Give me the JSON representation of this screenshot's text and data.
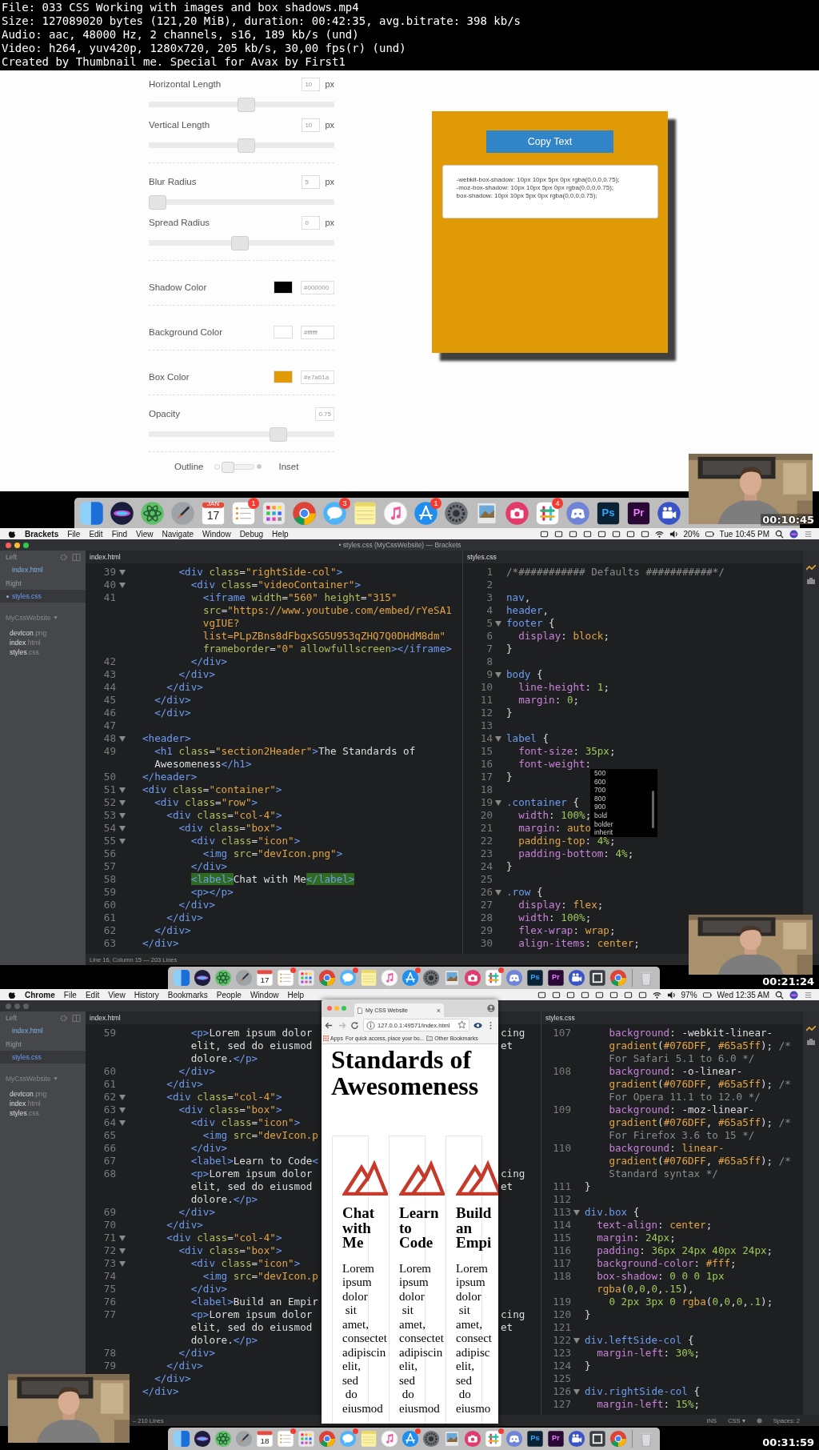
{
  "file_info": [
    "File: 033 CSS Working with images and box shadows.mp4",
    "Size: 127089020 bytes (121,20 MiB), duration: 00:42:35, avg.bitrate: 398 kb/s",
    "Audio: aac, 48000 Hz, 2 channels, s16, 189 kb/s (und)",
    "Video: h264, yuv420p, 1280x720, 205 kb/s, 30,00 fps(r) (und)",
    "Created by Thumbnail me. Special for Avax by First1"
  ],
  "frames": [
    {
      "kind": "generator",
      "timestamp": "00:10:45",
      "control_groups": [
        {
          "controls": [
            {
              "kind": "slider",
              "label": "Horizontal Length",
              "value": "10",
              "unit": "px",
              "level": 0.53
            },
            {
              "kind": "slider",
              "label": "Vertical Length",
              "value": "10",
              "unit": "px",
              "level": 0.53
            }
          ]
        },
        {
          "controls": [
            {
              "kind": "slider",
              "label": "Blur Radius",
              "value": "5",
              "unit": "px",
              "level": 0
            },
            {
              "kind": "slider",
              "label": "Spread Radius",
              "value": "0",
              "unit": "px",
              "level": 0.49
            }
          ]
        },
        {
          "controls": [
            {
              "kind": "color",
              "label": "Shadow Color",
              "color": "#000000",
              "value": "#000000"
            }
          ]
        },
        {
          "controls": [
            {
              "kind": "color",
              "label": "Background Color",
              "color": "#ffffff",
              "value": "#ffffff"
            }
          ]
        },
        {
          "controls": [
            {
              "kind": "color",
              "label": "Box Color",
              "color": "#e09a06",
              "value": "#e7a61a"
            }
          ]
        },
        {
          "controls": [
            {
              "kind": "slider",
              "label": "Opacity",
              "value": "0.75",
              "level": 0.72
            }
          ]
        },
        {
          "controls": [
            {
              "kind": "toggle",
              "off_label": "Outline",
              "on_label": "Inset",
              "on": false
            }
          ]
        }
      ],
      "preview": {
        "button": "Copy Text",
        "code": [
          "-webkit-box-shadow: 10px 10px 5px 0px rgba(0,0,0,0.75);",
          "-moz-box-shadow: 10px 10px 5px 0px rgba(0,0,0,0.75);",
          "box-shadow: 10px 10px 5px 0px rgba(0,0,0,0.75);"
        ]
      },
      "dock": [
        {
          "kind": "finder"
        },
        {
          "kind": "siri"
        },
        {
          "kind": "atom"
        },
        {
          "kind": "rocket"
        },
        {
          "kind": "calendar",
          "month": "JAN",
          "label": "17"
        },
        {
          "kind": "reminders",
          "badge": "1"
        },
        {
          "kind": "launchpad"
        },
        {
          "kind": "chrome"
        },
        {
          "kind": "messages",
          "badge": "3"
        },
        {
          "kind": "notes"
        },
        {
          "kind": "music"
        },
        {
          "kind": "appstore",
          "badge": "1"
        },
        {
          "kind": "settings"
        },
        {
          "kind": "preview"
        },
        {
          "kind": "camera"
        },
        {
          "kind": "slack",
          "badge": "4"
        },
        {
          "kind": "discord"
        },
        {
          "kind": "photoshop",
          "label": "Ps"
        },
        {
          "kind": "premiere",
          "label": "Pr"
        },
        {
          "kind": "clapper"
        }
      ]
    },
    {
      "kind": "editor",
      "timestamp": "00:21:24",
      "menu_bar": {
        "app": "Brackets",
        "menus": [
          "File",
          "Edit",
          "Find",
          "View",
          "Navigate",
          "Window",
          "Debug",
          "Help"
        ],
        "battery": "20%",
        "clock": "Tue 10:45 PM"
      },
      "window": {
        "active": true,
        "title": "• styles.css (MyCssWebsite) — Brackets"
      },
      "sidebar": {
        "working_sets": [
          {
            "label": "Left",
            "files": [
              {
                "name": "index.html",
                "selected": false,
                "modified": false
              }
            ]
          },
          {
            "label": "Right",
            "files": [
              {
                "name": "styles.css",
                "selected": true,
                "modified": true
              }
            ]
          }
        ],
        "project": "MyCssWebsite",
        "project_files": [
          "devIcon.png",
          "index.html",
          "styles.css"
        ]
      },
      "panes": [
        {
          "tab": "index.html",
          "kind": "html",
          "lines": [
            {
              "number": "39",
              "fold": true,
              "code": "      <div class=\"rightSide-col\">"
            },
            {
              "number": "40",
              "fold": true,
              "code": "        <div class=\"videoContainer\">"
            },
            {
              "number": "41",
              "fold": false,
              "code": "          <iframe width=\"560\" height=\"315\""
            },
            {
              "fold": false,
              "code": "          src=\"https://www.youtube.com/embed/rYeSA1"
            },
            {
              "fold": false,
              "code": "          vgIUE?"
            },
            {
              "fold": false,
              "code": "          list=PLpZBns8dFbgxSG5U953qZHQ7Q0DHdM8dm\""
            },
            {
              "fold": false,
              "code": "          frameborder=\"0\" allowfullscreen></iframe>"
            },
            {
              "number": "42",
              "fold": false,
              "code": "        </div>"
            },
            {
              "number": "43",
              "fold": false,
              "code": "      </div>"
            },
            {
              "number": "44",
              "fold": false,
              "code": "    </div>"
            },
            {
              "number": "45",
              "fold": false,
              "code": "  </div>"
            },
            {
              "number": "46",
              "fold": false,
              "code": "  </div>"
            },
            {
              "number": "47",
              "fold": false
            },
            {
              "number": "48",
              "fold": true,
              "code": "<header>"
            },
            {
              "number": "49",
              "fold": false,
              "code": "  <h1 class=\"section2Header\">The Standards of"
            },
            {
              "fold": false,
              "code": "  Awesomeness</h1>"
            },
            {
              "number": "50",
              "fold": false,
              "code": "</header>"
            },
            {
              "number": "51",
              "fold": true,
              "code": "<div class=\"container\">"
            },
            {
              "number": "52",
              "fold": true,
              "code": "  <div class=\"row\">"
            },
            {
              "number": "53",
              "fold": true,
              "code": "    <div class=\"col-4\">"
            },
            {
              "number": "54",
              "fold": true,
              "code": "      <div class=\"box\">"
            },
            {
              "number": "55",
              "fold": true,
              "code": "        <div class=\"icon\">"
            },
            {
              "number": "56",
              "fold": false,
              "code": "          <img src=\"devIcon.png\">"
            },
            {
              "number": "57",
              "fold": false,
              "code": "        </div>"
            },
            {
              "number": "58",
              "fold": false,
              "matched": true,
              "code": "        <label>Chat with Me</label>"
            },
            {
              "number": "59",
              "fold": false,
              "code": "        <p></p>"
            },
            {
              "number": "60",
              "fold": false,
              "code": "      </div>"
            },
            {
              "number": "61",
              "fold": false,
              "code": "    </div>"
            },
            {
              "number": "62",
              "fold": false,
              "code": "  </div>"
            },
            {
              "number": "63",
              "fold": false,
              "code": "</div>"
            }
          ]
        },
        {
          "tab": "styles.css",
          "kind": "css",
          "lines": [
            {
              "number": "1",
              "fold": false,
              "code": "/*########### Defaults ###########*/"
            },
            {
              "number": "2",
              "fold": false
            },
            {
              "number": "3",
              "fold": false,
              "code": "nav,"
            },
            {
              "number": "4",
              "fold": false,
              "code": "header,"
            },
            {
              "number": "5",
              "fold": true,
              "code": "footer {"
            },
            {
              "number": "6",
              "fold": false,
              "code": "  display: block;"
            },
            {
              "number": "7",
              "fold": false,
              "code": "}"
            },
            {
              "number": "8",
              "fold": false
            },
            {
              "number": "9",
              "fold": true,
              "code": "body {"
            },
            {
              "number": "10",
              "fold": false,
              "code": "  line-height: 1;"
            },
            {
              "number": "11",
              "fold": false,
              "code": "  margin: 0;"
            },
            {
              "number": "12",
              "fold": false,
              "code": "}"
            },
            {
              "number": "13",
              "fold": false
            },
            {
              "number": "14",
              "fold": true,
              "code": "label {"
            },
            {
              "number": "15",
              "fold": false,
              "code": "  font-size: 35px;"
            },
            {
              "number": "16",
              "fold": false,
              "code": "  font-weight:"
            },
            {
              "number": "17",
              "fold": false,
              "code": "}"
            },
            {
              "number": "18",
              "fold": false
            },
            {
              "number": "19",
              "fold": true,
              "code": ".container {"
            },
            {
              "number": "20",
              "fold": false,
              "code": "  width: 100%;"
            },
            {
              "number": "21",
              "fold": false,
              "code": "  margin: auto"
            },
            {
              "number": "22",
              "fold": false,
              "code": "  padding-top: 4%;"
            },
            {
              "number": "23",
              "fold": false,
              "code": "  padding-bottom: 4%;"
            },
            {
              "number": "24",
              "fold": false,
              "code": "}"
            },
            {
              "number": "25",
              "fold": false
            },
            {
              "number": "26",
              "fold": true,
              "code": ".row {"
            },
            {
              "number": "27",
              "fold": false,
              "code": "  display: flex;"
            },
            {
              "number": "28",
              "fold": false,
              "code": "  width: 100%;"
            },
            {
              "number": "29",
              "fold": false,
              "code": "  flex-wrap: wrap;"
            },
            {
              "number": "30",
              "fold": false,
              "code": "  align-items: center;"
            }
          ]
        }
      ],
      "autocomplete": [
        "500",
        "600",
        "700",
        "800",
        "900",
        "bold",
        "bolder",
        "inherit"
      ],
      "status": {
        "left": "Line 16, Column 15 — 203 Lines"
      },
      "dock": [
        {
          "kind": "finder",
          "alert": false
        },
        {
          "kind": "siri",
          "alert": false
        },
        {
          "kind": "atom",
          "alert": false
        },
        {
          "kind": "rocket",
          "alert": false
        },
        {
          "kind": "calendar",
          "label": "17",
          "alert": false
        },
        {
          "kind": "reminders",
          "alert": true
        },
        {
          "kind": "launchpad",
          "alert": false
        },
        {
          "kind": "chrome",
          "alert": false
        },
        {
          "kind": "messages",
          "alert": true
        },
        {
          "kind": "notes",
          "alert": false
        },
        {
          "kind": "music",
          "alert": false
        },
        {
          "kind": "appstore",
          "alert": true
        },
        {
          "kind": "settings",
          "alert": false
        },
        {
          "kind": "preview",
          "alert": false
        },
        {
          "kind": "camera",
          "alert": false
        },
        {
          "kind": "slack",
          "alert": true
        },
        {
          "kind": "discord",
          "alert": false
        },
        {
          "kind": "photoshop",
          "label": "Ps",
          "alert": false
        },
        {
          "kind": "premiere",
          "label": "Pr",
          "alert": false
        },
        {
          "kind": "clapper",
          "alert": false
        },
        {
          "kind": "screenshot",
          "alert": false
        },
        {
          "kind": "chrome",
          "alert": false
        },
        {
          "kind": "separator"
        },
        {
          "kind": "trash",
          "alert": false
        }
      ]
    },
    {
      "kind": "editor",
      "timestamp": "00:31:59",
      "menu_bar": {
        "app": "Chrome",
        "menus": [
          "File",
          "Edit",
          "View",
          "History",
          "Bookmarks",
          "People",
          "Window",
          "Help"
        ],
        "battery": "97%",
        "clock": "Wed 12:35 AM"
      },
      "window": {
        "active": false
      },
      "sidebar": {
        "working_sets": [
          {
            "label": "Left",
            "files": [
              {
                "name": "index.html",
                "selected": false,
                "modified": false
              }
            ]
          },
          {
            "label": "Right",
            "files": [
              {
                "name": "styles.css",
                "selected": true,
                "modified": false
              }
            ]
          }
        ],
        "project": "MyCssWebsite",
        "project_files": [
          "devIcon.png",
          "index.html",
          "styles.css"
        ]
      },
      "panes": [
        {
          "tab": "index.html",
          "kind": "html",
          "lines": [
            {
              "number": "59",
              "fold": false,
              "code": "        <p>Lorem ipsum dolor",
              "tail": "cing"
            },
            {
              "fold": false,
              "code": "        elit, sed do eiusmod",
              "tail": "et"
            },
            {
              "fold": false,
              "code": "        dolore.</p>"
            },
            {
              "number": "60",
              "fold": false,
              "code": "      </div>"
            },
            {
              "number": "61",
              "fold": false,
              "code": "    </div>"
            },
            {
              "number": "62",
              "fold": true,
              "code": "    <div class=\"col-4\">"
            },
            {
              "number": "63",
              "fold": true,
              "code": "      <div class=\"box\">"
            },
            {
              "number": "64",
              "fold": true,
              "code": "        <div class=\"icon\">"
            },
            {
              "number": "65",
              "fold": false,
              "code": "          <img src=\"devIcon.p"
            },
            {
              "number": "66",
              "fold": false,
              "code": "        </div>"
            },
            {
              "number": "67",
              "fold": false,
              "code": "        <label>Learn to Code<"
            },
            {
              "number": "68",
              "fold": false,
              "code": "        <p>Lorem ipsum dolor",
              "tail": "cing"
            },
            {
              "fold": false,
              "code": "        elit, sed do eiusmod",
              "tail": "et"
            },
            {
              "fold": false,
              "code": "        dolore.</p>"
            },
            {
              "number": "69",
              "fold": false,
              "code": "      </div>"
            },
            {
              "number": "70",
              "fold": false,
              "code": "    </div>"
            },
            {
              "number": "71",
              "fold": true,
              "code": "    <div class=\"col-4\">"
            },
            {
              "number": "72",
              "fold": true,
              "code": "      <div class=\"box\">"
            },
            {
              "number": "73",
              "fold": true,
              "code": "        <div class=\"icon\">"
            },
            {
              "number": "74",
              "fold": false,
              "code": "          <img src=\"devIcon.p"
            },
            {
              "number": "75",
              "fold": false,
              "code": "        </div>"
            },
            {
              "number": "76",
              "fold": false,
              "code": "        <label>Build an Empir"
            },
            {
              "number": "77",
              "fold": false,
              "code": "        <p>Lorem ipsum dolor",
              "tail": "cing"
            },
            {
              "fold": false,
              "code": "        elit, sed do eiusmod",
              "tail": "et"
            },
            {
              "fold": false,
              "code": "        dolore.</p>"
            },
            {
              "number": "78",
              "fold": false,
              "code": "      </div>"
            },
            {
              "number": "79",
              "fold": false,
              "code": "    </div>"
            },
            {
              "fold": false,
              "code": "  </div>"
            },
            {
              "fold": false,
              "code": "</div>"
            }
          ]
        },
        {
          "tab": "styles.css",
          "kind": "css",
          "lines": [
            {
              "number": "107",
              "fold": false,
              "code": "    background: -webkit-linear-"
            },
            {
              "fold": false,
              "code": "    gradient(#076DFF, #65a5ff); /*"
            },
            {
              "fold": false,
              "code": "    For Safari 5.1 to 6.0 */"
            },
            {
              "number": "108",
              "fold": false,
              "code": "    background: -o-linear-"
            },
            {
              "fold": false,
              "code": "    gradient(#076DFF, #65a5ff); /*"
            },
            {
              "fold": false,
              "code": "    For Opera 11.1 to 12.0 */"
            },
            {
              "number": "109",
              "fold": false,
              "code": "    background: -moz-linear-"
            },
            {
              "fold": false,
              "code": "    gradient(#076DFF, #65a5ff); /*"
            },
            {
              "fold": false,
              "code": "    For Firefox 3.6 to 15 */"
            },
            {
              "number": "110",
              "fold": false,
              "code": "    background: linear-"
            },
            {
              "fold": false,
              "code": "    gradient(#076DFF, #65a5ff); /*"
            },
            {
              "fold": false,
              "code": "    Standard syntax */"
            },
            {
              "number": "111",
              "fold": false,
              "code": "}"
            },
            {
              "number": "112",
              "fold": false
            },
            {
              "number": "113",
              "fold": true,
              "code": "div.box {"
            },
            {
              "number": "114",
              "fold": false,
              "code": "  text-align: center;"
            },
            {
              "number": "115",
              "fold": false,
              "code": "  margin: 24px;"
            },
            {
              "number": "116",
              "fold": false,
              "code": "  padding: 36px 24px 40px 24px;"
            },
            {
              "number": "117",
              "fold": false,
              "code": "  background-color: #fff;"
            },
            {
              "number": "118",
              "fold": false,
              "code": "  box-shadow: 0 0 0 1px"
            },
            {
              "fold": false,
              "code": "  rgba(0,0,0,.15),"
            },
            {
              "number": "119",
              "fold": false,
              "code": "    0 2px 3px 0 rgba(0,0,0,.1);"
            },
            {
              "number": "120",
              "fold": false,
              "code": "}"
            },
            {
              "number": "121",
              "fold": false
            },
            {
              "number": "122",
              "fold": true,
              "code": "div.leftSide-col {"
            },
            {
              "number": "123",
              "fold": false,
              "code": "  margin-left: 30%;"
            },
            {
              "number": "124",
              "fold": false,
              "code": "}"
            },
            {
              "number": "125",
              "fold": false
            },
            {
              "number": "126",
              "fold": true,
              "code": "div.rightSide-col {"
            },
            {
              "number": "127",
              "fold": false,
              "code": "  margin-left: 15%;"
            }
          ]
        }
      ],
      "status": {
        "left": "– 210 Lines",
        "right": [
          "INS",
          "CSS ▾",
          "Spaces: 2"
        ]
      },
      "browser": {
        "tab": "My CSS Website",
        "close": "×",
        "url": "127.0.0.1:49571/index.html",
        "bookmarks": [
          "Apps",
          "For quick access, place your bo...",
          "Other Bookmarks"
        ],
        "heading": "Standards of Awesomeness",
        "cards": [
          {
            "title": "Chat with Me",
            "lines": [
              "Lorem",
              "ipsum",
              "dolor",
              " sit",
              "amet,",
              "consectet",
              "adipiscin",
              "elit,",
              "sed",
              " do",
              "eiusmod"
            ]
          },
          {
            "title": "Learn to Code",
            "lines": [
              "Lorem",
              "ipsum",
              "dolor",
              " sit",
              "amet,",
              "consectet",
              "adipiscin",
              "elit,",
              "sed",
              " do",
              "eiusmod"
            ]
          },
          {
            "title": "Build an Empi",
            "lines": [
              "Lorem",
              "ipsum",
              "dolor",
              " sit",
              "amet,",
              "consect",
              "adipisc",
              "elit,",
              "sed",
              " do",
              "eiusmo"
            ]
          }
        ]
      },
      "dock": [
        {
          "kind": "finder",
          "alert": false
        },
        {
          "kind": "siri",
          "alert": false
        },
        {
          "kind": "atom",
          "alert": false
        },
        {
          "kind": "rocket",
          "alert": false
        },
        {
          "kind": "calendar",
          "label": "18",
          "alert": false
        },
        {
          "kind": "reminders",
          "alert": true
        },
        {
          "kind": "launchpad",
          "alert": false
        },
        {
          "kind": "chrome",
          "alert": false
        },
        {
          "kind": "messages",
          "alert": true
        },
        {
          "kind": "notes",
          "alert": false
        },
        {
          "kind": "music",
          "alert": false
        },
        {
          "kind": "appstore",
          "alert": true
        },
        {
          "kind": "settings",
          "alert": false
        },
        {
          "kind": "preview",
          "alert": false
        },
        {
          "kind": "camera",
          "alert": false
        },
        {
          "kind": "slack",
          "alert": true
        },
        {
          "kind": "discord",
          "alert": false
        },
        {
          "kind": "photoshop",
          "label": "Ps",
          "alert": false
        },
        {
          "kind": "premiere",
          "label": "Pr",
          "alert": false
        },
        {
          "kind": "clapper",
          "alert": false
        },
        {
          "kind": "screenshot",
          "alert": false
        },
        {
          "kind": "chrome",
          "alert": false
        },
        {
          "kind": "separator"
        },
        {
          "kind": "trash",
          "alert": false
        }
      ]
    }
  ]
}
